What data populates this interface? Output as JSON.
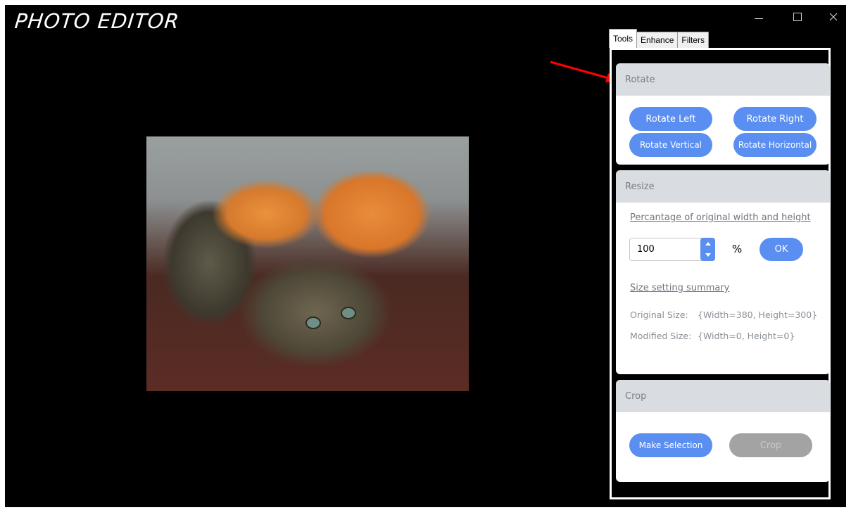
{
  "app": {
    "title": "PHOTO EDITOR"
  },
  "window_controls": {
    "minimize": "minimize-icon",
    "maximize": "maximize-icon",
    "close": "close-icon"
  },
  "colors": {
    "accent": "#5b8ef1",
    "disabled": "#a3a3a3",
    "annotation_arrow": "#ff0000"
  },
  "tabs": [
    {
      "label": "Tools",
      "active": true
    },
    {
      "label": "Enhance",
      "active": false
    },
    {
      "label": "Filters",
      "active": false
    }
  ],
  "rotate": {
    "header": "Rotate",
    "rotate_left": "Rotate Left",
    "rotate_right": "Rotate Right",
    "rotate_vertical": "Rotate Vertical",
    "rotate_horizontal": "Rotate Horizontal"
  },
  "resize": {
    "header": "Resize",
    "percentage_link": "Percantage of original width and height",
    "percentage_value": "100",
    "percent_symbol": "%",
    "ok": "OK",
    "summary_link": "Size setting summary",
    "original_label": "Original Size:",
    "original_value": "{Width=380, Height=300}",
    "modified_label": "Modified Size:",
    "modified_value": "{Width=0, Height=0}"
  },
  "crop": {
    "header": "Crop",
    "make_selection": "Make Selection",
    "crop_button": "Crop"
  }
}
